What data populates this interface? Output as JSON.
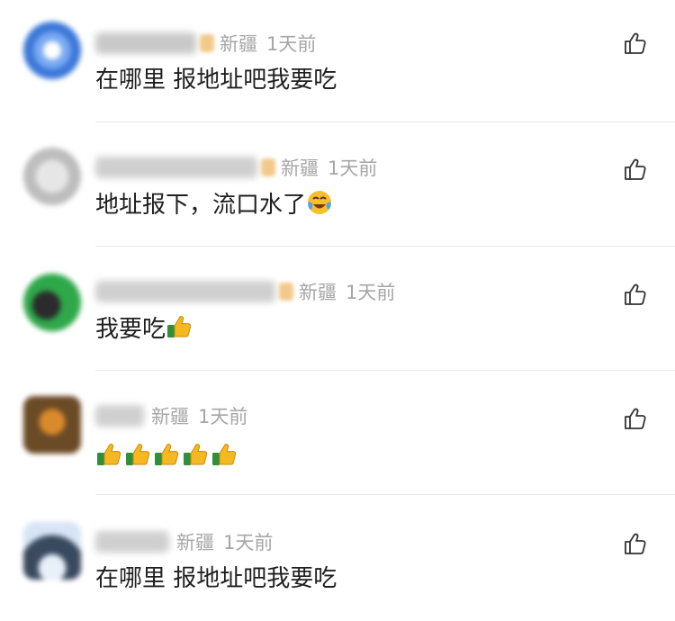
{
  "comments": [
    {
      "location": "新疆",
      "time": "1天前",
      "text": "在哪里 报地址吧我要吃",
      "emoji": [],
      "avatar_color": "#4a86e8"
    },
    {
      "location": "新疆",
      "time": "1天前",
      "text": "地址报下，流口水了",
      "emoji": [
        "laughing-tears-emoji"
      ],
      "avatar_color": "#cfcfcf"
    },
    {
      "location": "新疆",
      "time": "1天前",
      "text": "我要吃",
      "emoji": [
        "thumbs-up-emoji"
      ],
      "avatar_color": "#2ea84a"
    },
    {
      "location": "新疆",
      "time": "1天前",
      "text": "",
      "emoji": [
        "thumbs-up-emoji",
        "thumbs-up-emoji",
        "thumbs-up-emoji",
        "thumbs-up-emoji",
        "thumbs-up-emoji"
      ],
      "avatar_color": "#9a6b3a"
    },
    {
      "location": "新疆",
      "time": "1天前",
      "text": "在哪里 报地址吧我要吃",
      "emoji": [],
      "avatar_color": "#5a6f8a"
    }
  ],
  "icons": {
    "like": "thumb-up-outline-icon"
  }
}
